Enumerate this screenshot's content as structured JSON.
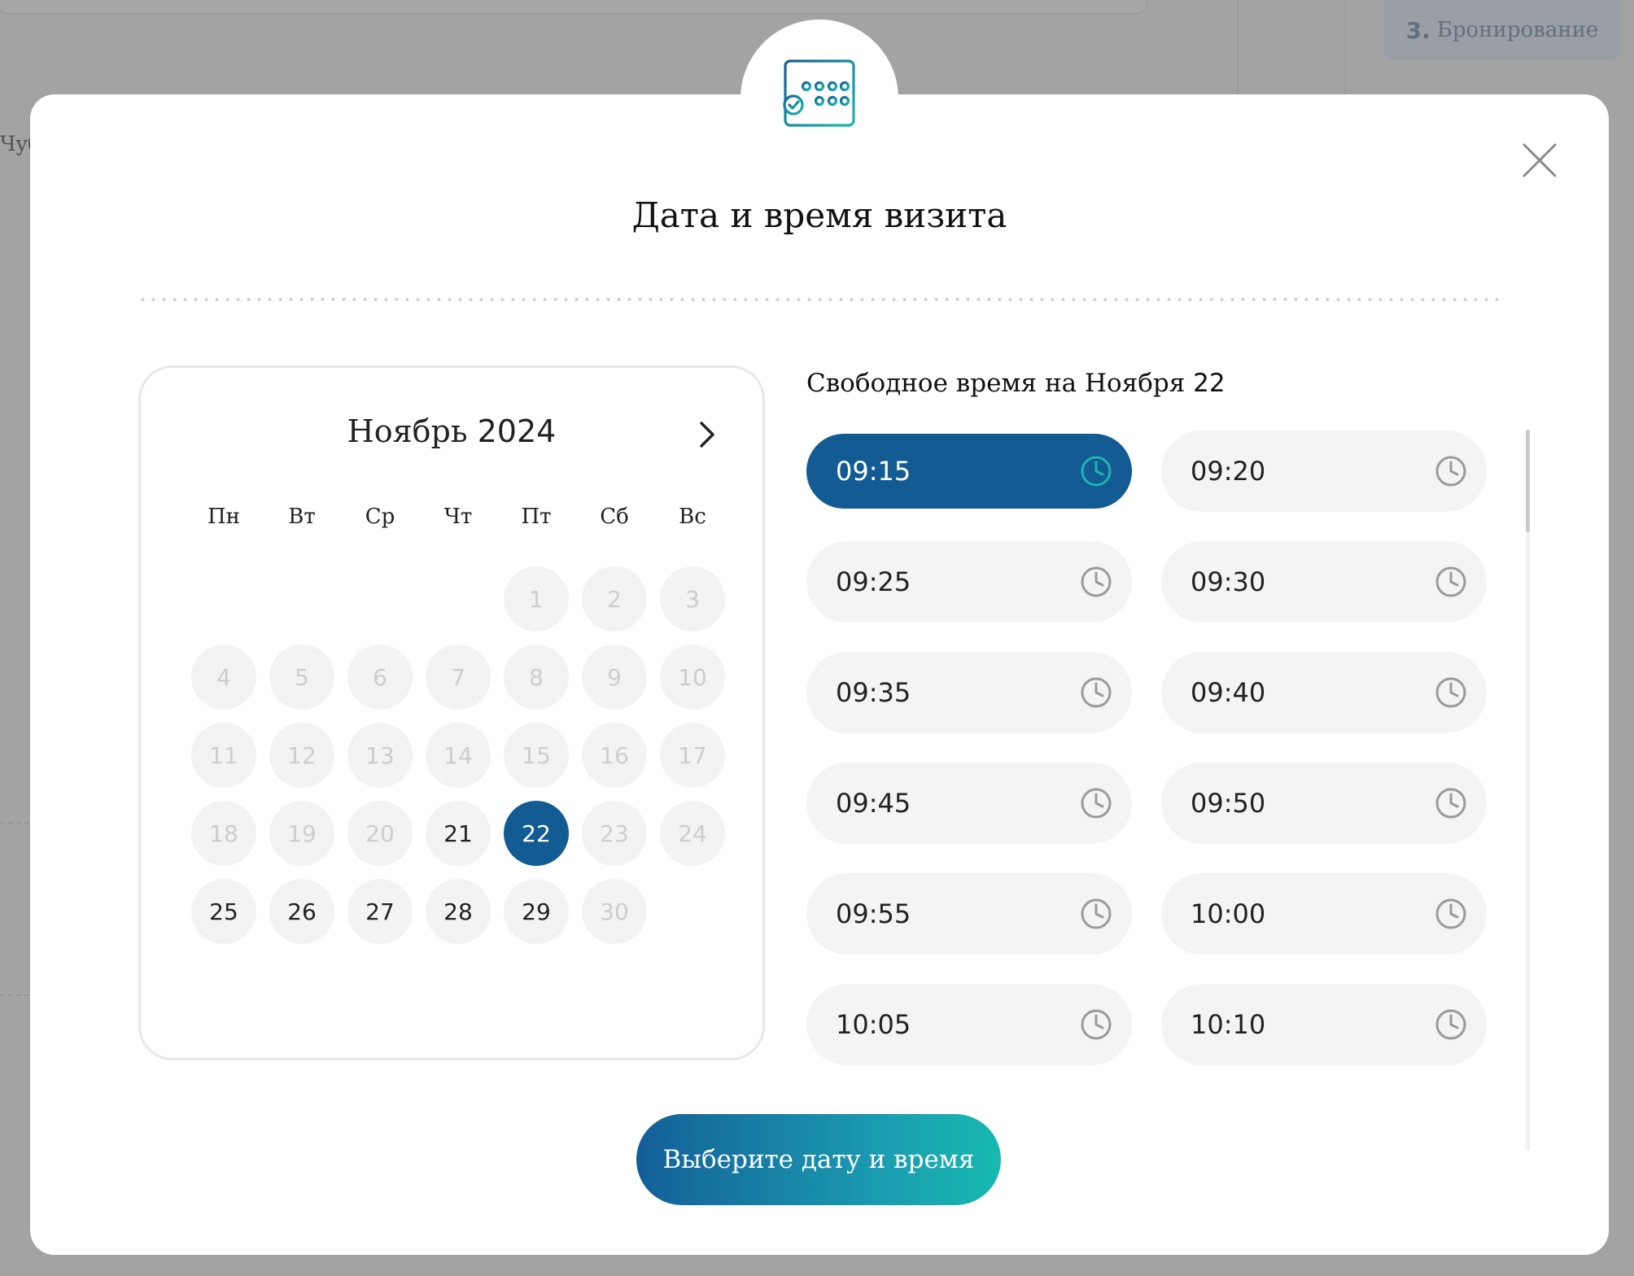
{
  "background": {
    "step_number": "3.",
    "step_label": "Бронирование",
    "peek_text": "Чуб"
  },
  "modal": {
    "title": "Дата и время визита",
    "icon": "calendar-check-icon",
    "close_icon": "close-icon"
  },
  "calendar": {
    "month": "Ноябрь",
    "year": "2024",
    "next_icon": "chevron-right-icon",
    "weekdays": [
      "Пн",
      "Вт",
      "Ср",
      "Чт",
      "Пт",
      "Сб",
      "Вс"
    ],
    "leading_blanks": 4,
    "days": [
      {
        "n": "1",
        "state": "disabled"
      },
      {
        "n": "2",
        "state": "disabled"
      },
      {
        "n": "3",
        "state": "disabled"
      },
      {
        "n": "4",
        "state": "disabled"
      },
      {
        "n": "5",
        "state": "disabled"
      },
      {
        "n": "6",
        "state": "disabled"
      },
      {
        "n": "7",
        "state": "disabled"
      },
      {
        "n": "8",
        "state": "disabled"
      },
      {
        "n": "9",
        "state": "disabled"
      },
      {
        "n": "10",
        "state": "disabled"
      },
      {
        "n": "11",
        "state": "disabled"
      },
      {
        "n": "12",
        "state": "disabled"
      },
      {
        "n": "13",
        "state": "disabled"
      },
      {
        "n": "14",
        "state": "disabled"
      },
      {
        "n": "15",
        "state": "disabled"
      },
      {
        "n": "16",
        "state": "disabled"
      },
      {
        "n": "17",
        "state": "disabled"
      },
      {
        "n": "18",
        "state": "disabled"
      },
      {
        "n": "19",
        "state": "disabled"
      },
      {
        "n": "20",
        "state": "disabled"
      },
      {
        "n": "21",
        "state": "available"
      },
      {
        "n": "22",
        "state": "selected"
      },
      {
        "n": "23",
        "state": "disabled"
      },
      {
        "n": "24",
        "state": "disabled"
      },
      {
        "n": "25",
        "state": "available"
      },
      {
        "n": "26",
        "state": "available"
      },
      {
        "n": "27",
        "state": "available"
      },
      {
        "n": "28",
        "state": "available"
      },
      {
        "n": "29",
        "state": "available"
      },
      {
        "n": "30",
        "state": "disabled"
      }
    ]
  },
  "slots": {
    "title_prefix": "Свободное время на Ноября",
    "title_day": "22",
    "clock_icon": "clock-icon",
    "items": [
      {
        "time": "09:15",
        "active": true
      },
      {
        "time": "09:20",
        "active": false
      },
      {
        "time": "09:25",
        "active": false
      },
      {
        "time": "09:30",
        "active": false
      },
      {
        "time": "09:35",
        "active": false
      },
      {
        "time": "09:40",
        "active": false
      },
      {
        "time": "09:45",
        "active": false
      },
      {
        "time": "09:50",
        "active": false
      },
      {
        "time": "09:55",
        "active": false
      },
      {
        "time": "10:00",
        "active": false
      },
      {
        "time": "10:05",
        "active": false
      },
      {
        "time": "10:10",
        "active": false
      }
    ]
  },
  "submit": {
    "label": "Выберите дату и время"
  },
  "colors": {
    "primary": "#125c93",
    "accent_teal": "#1fb5b0",
    "slot_bg": "#f4f4f4",
    "disabled_text": "#cdcdcd"
  }
}
